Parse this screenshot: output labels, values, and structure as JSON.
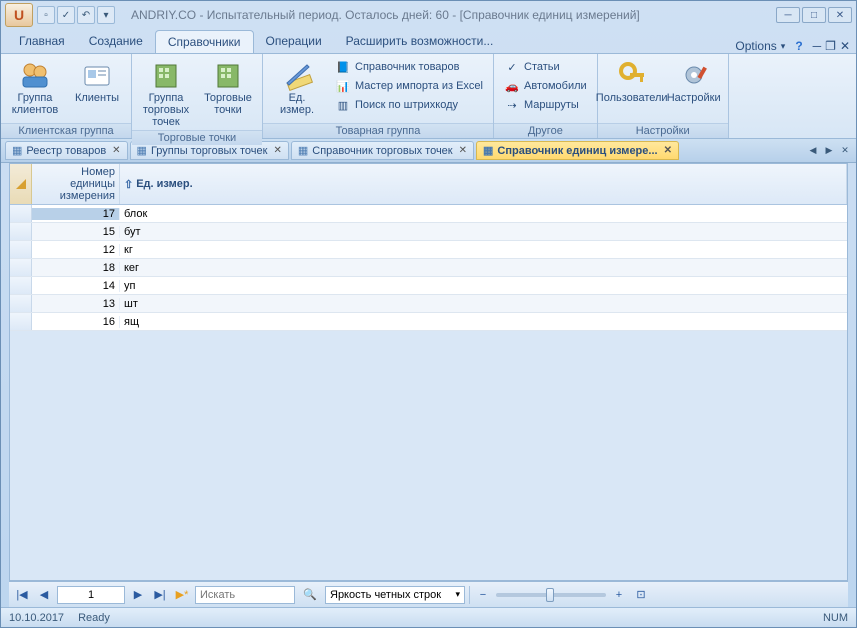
{
  "title": "ANDRIY.CO - Испытательный период. Осталось дней: 60 - [Справочник единиц измерений]",
  "menu": {
    "items": [
      "Главная",
      "Создание",
      "Справочники",
      "Операции",
      "Расширить возможности..."
    ],
    "active": 2,
    "options": "Options"
  },
  "ribbon": {
    "groups": [
      {
        "label": "Клиентская группа",
        "big": [
          {
            "id": "group-clients",
            "label": "Группа\nклиентов"
          },
          {
            "id": "clients",
            "label": "Клиенты"
          }
        ],
        "small": []
      },
      {
        "label": "Торговые точки",
        "big": [
          {
            "id": "group-trade-points",
            "label": "Группа\nторговых точек"
          },
          {
            "id": "trade-points",
            "label": "Торговые\nточки"
          }
        ],
        "small": []
      },
      {
        "label": "Товарная группа",
        "big": [
          {
            "id": "unit-measure",
            "label": "Ед.\nизмер."
          }
        ],
        "small": [
          {
            "id": "goods-catalog",
            "label": "Справочник товаров"
          },
          {
            "id": "import-wizard",
            "label": "Мастер импорта из Excel"
          },
          {
            "id": "barcode-search",
            "label": "Поиск по штрихкоду"
          }
        ]
      },
      {
        "label": "Другое",
        "big": [],
        "small": [
          {
            "id": "articles",
            "label": "Статьи"
          },
          {
            "id": "cars",
            "label": "Автомобили"
          },
          {
            "id": "routes",
            "label": "Маршруты"
          }
        ]
      },
      {
        "label": "Настройки",
        "big": [
          {
            "id": "users",
            "label": "Пользователи"
          },
          {
            "id": "settings",
            "label": "Настройки"
          }
        ],
        "small": []
      }
    ]
  },
  "tabs": [
    {
      "label": "Реестр товаров",
      "active": false
    },
    {
      "label": "Группы торговых точек",
      "active": false
    },
    {
      "label": "Справочник торговых точек",
      "active": false
    },
    {
      "label": "Справочник единиц измере...",
      "active": true
    }
  ],
  "grid": {
    "col_num": "Номер единицы измерения",
    "col_name": "Ед. измер.",
    "rows": [
      {
        "num": "17",
        "name": "блок",
        "sel": true
      },
      {
        "num": "15",
        "name": "бут"
      },
      {
        "num": "12",
        "name": "кг"
      },
      {
        "num": "18",
        "name": "кег"
      },
      {
        "num": "14",
        "name": "уп"
      },
      {
        "num": "13",
        "name": "шт"
      },
      {
        "num": "16",
        "name": "ящ"
      }
    ]
  },
  "nav": {
    "page": "1",
    "search_placeholder": "Искать",
    "combo": "Яркость четных строк"
  },
  "status": {
    "date": "10.10.2017",
    "state": "Ready",
    "num": "NUM"
  }
}
